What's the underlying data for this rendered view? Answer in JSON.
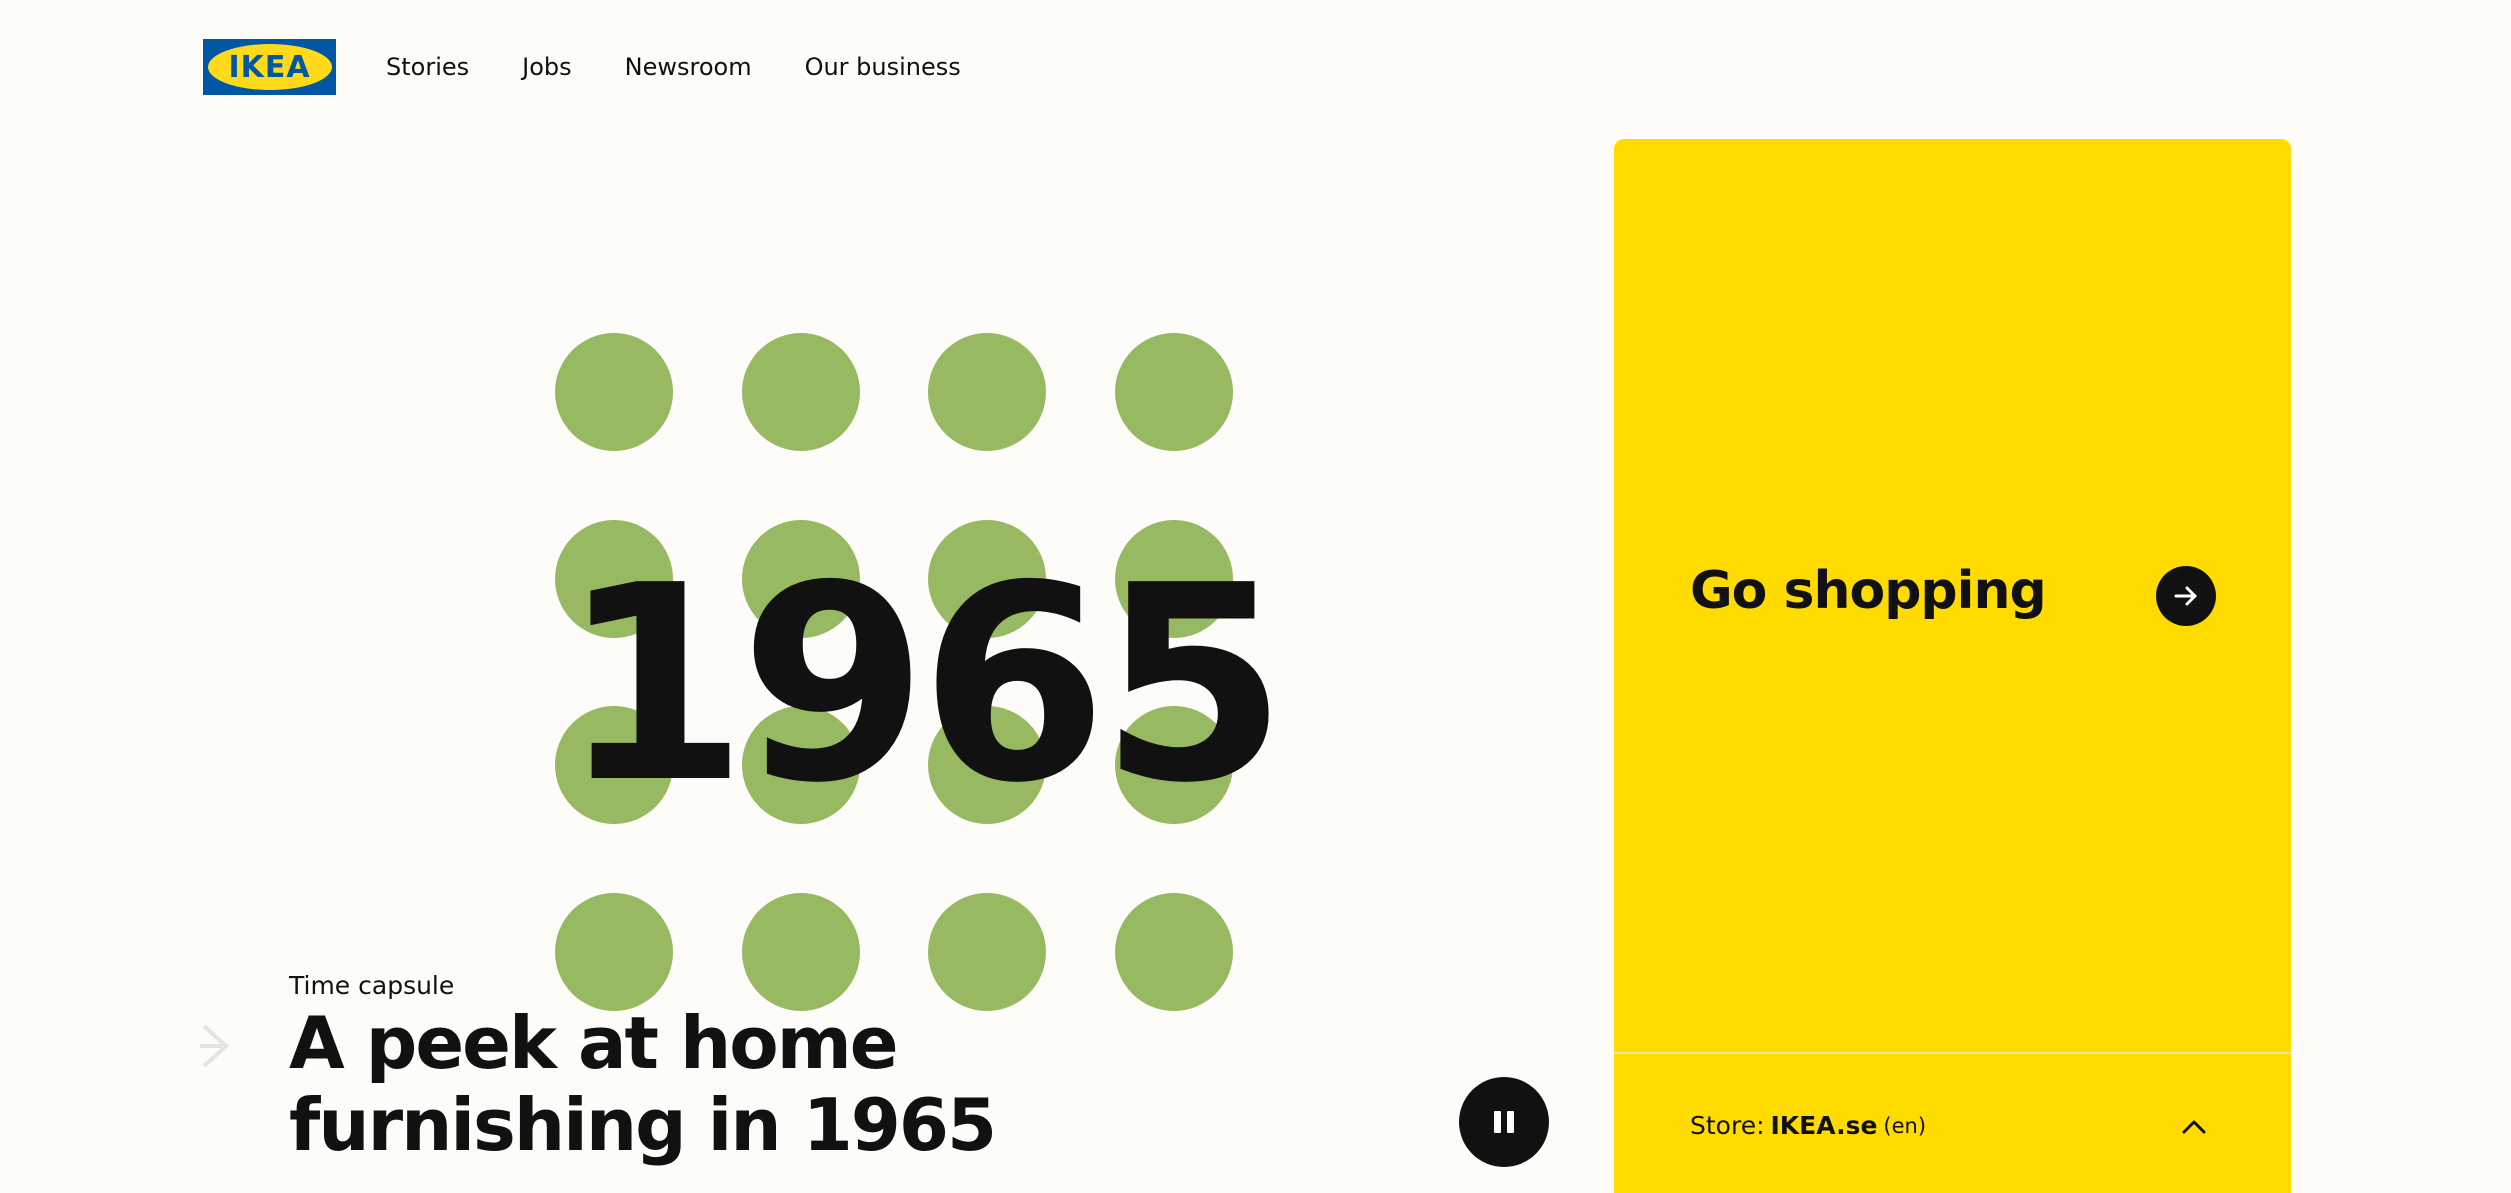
{
  "header": {
    "logo_text": "IKEA",
    "nav": [
      {
        "label": "Stories"
      },
      {
        "label": "Jobs"
      },
      {
        "label": "Newsroom"
      },
      {
        "label": "Our business"
      }
    ]
  },
  "hero": {
    "year": "1965",
    "eyebrow": "Time capsule",
    "headline_line1": "A peek at home",
    "headline_line2": "furnishing in 1965",
    "dot_color": "#97b962",
    "prev_icon": "chevron-right-icon",
    "pause_icon": "pause-icon"
  },
  "side_panel": {
    "shop_label": "Go shopping",
    "shop_icon": "arrow-right-icon",
    "store_prefix": "Store:",
    "store_name": "IKEA.se",
    "store_lang": "(en)",
    "toggle_icon": "chevron-up-icon",
    "background": "#ffdb00"
  },
  "colors": {
    "brand_blue": "#0058a3",
    "brand_yellow": "#ffda1a",
    "page_bg": "#fdfcf8",
    "text": "#111111"
  }
}
